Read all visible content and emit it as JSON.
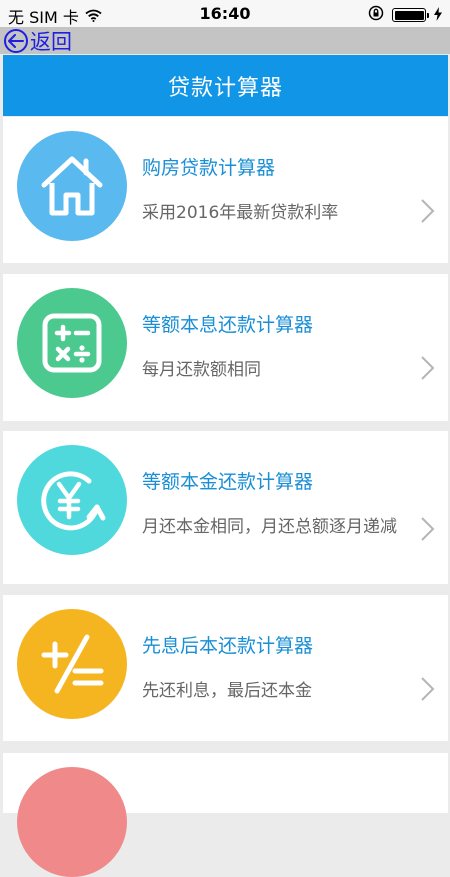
{
  "status_bar": {
    "carrier": "无 SIM 卡",
    "time": "16:40",
    "battery_level": 1.0
  },
  "nav": {
    "back_label": "返回"
  },
  "header": {
    "title": "贷款计算器"
  },
  "calculators": [
    {
      "title": "购房贷款计算器",
      "description": "采用2016年最新贷款利率",
      "icon": "house-icon",
      "color": "#5ab9ef"
    },
    {
      "title": "等额本息还款计算器",
      "description": "每月还款额相同",
      "icon": "calculator-icon",
      "color": "#4cc98e"
    },
    {
      "title": "等额本金还款计算器",
      "description": "月还本金相同，月还总额逐月递减",
      "icon": "yen-refresh-icon",
      "color": "#4fd9dd"
    },
    {
      "title": "先息后本还款计算器",
      "description": "先还利息，最后还本金",
      "icon": "plus-equals-icon",
      "color": "#f5b521"
    },
    {
      "icon": "partial-item-icon",
      "color": "#f08a8a"
    }
  ]
}
